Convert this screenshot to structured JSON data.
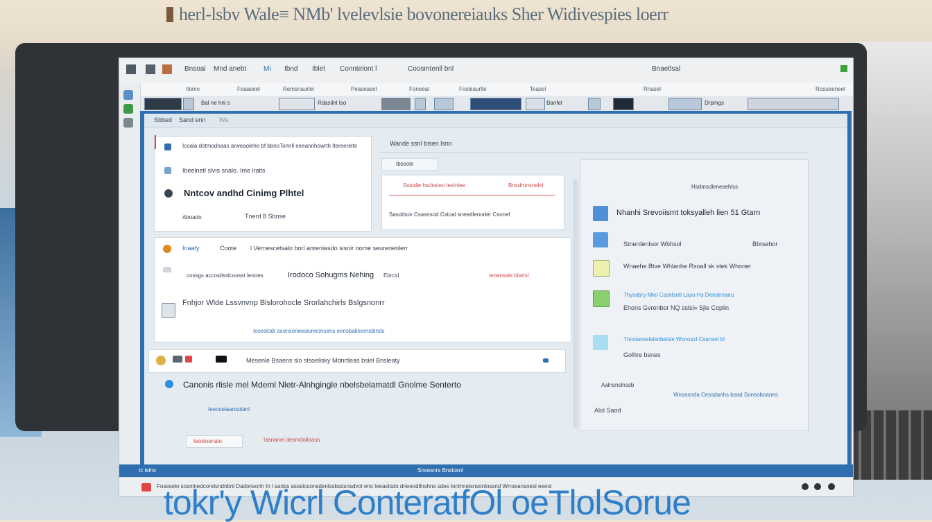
{
  "header": {
    "title": "herl-lsbv Wale≡ NMb' lvelevlsie bovonereiauks Sher Widivespies loerr"
  },
  "menubar": {
    "items": [
      "Bnsoal",
      "Mnd anebt",
      "Mi",
      "Ibnd",
      "Iblet",
      "Conntelont l",
      "Coosmtenll bnl"
    ],
    "right": "Bnaetlsal"
  },
  "toolbar_labels": [
    "Itomo",
    "Feaaseel",
    "Remsnaurlel",
    "Peaseasel",
    "Foneeal",
    "Fosleaurlte",
    "Teasel",
    "Rnasel",
    "Rosueeneel"
  ],
  "ribbon_labels": [
    "Bal ne hnl s",
    "Rdasilnl Iso",
    "Banfel",
    "Drpmgs"
  ],
  "dialog": {
    "tabs": [
      "Sbbed",
      "Sand enn",
      "Wa"
    ],
    "left_panel": {
      "item1": "Icoala dotmodnaas arweaolehe bf bbnoTonnll eeeannhowrth Itereerelte",
      "item2": "Ibeelnetl slvis snalo. Ime lratls",
      "heading": "Nntcov andhd Cinimg Plhtel",
      "sub_left": "Aboado",
      "sub_right": "Tnerd 8 Sbnse"
    },
    "mid_panel": {
      "top": "Wande ssnl bisen lsnn",
      "tab": "Ibssole",
      "pink_left": "Sosidle hsdnsleo leslnlee",
      "pink_right": "Bnsdrnnsnelsl",
      "line": "Sasddsor Csasnsod Cstoal sneedlenoder Csonel"
    },
    "wide_panel": {
      "row1_a": "Inaaty",
      "row1_b": "Coote",
      "row1_c": "l Vernescetsalo borl anreniasdo sisnir oome seurenenlerr",
      "row2_a": "cossgs accostlsslcoosst lenoes",
      "row2_b": "Irodoco Sohugms Nehing",
      "row2_c": "Ebrcsl",
      "row2_right": "Ienenssle blarlsl",
      "row3": "Fnhjor Wlde Lssvnvnp Blslorohocle Srorlahchirls Bslgsnonrr",
      "row3_bottom": "Ioseslodr ssonsoneesioneonsens eensbalieernsblnds"
    },
    "notice": {
      "text": "Mesenle Bsaens slo slsoelisky Mdnrtleas bsiel Bnsleaty",
      "line": "Canonis rlisle mel Mdeml Nletr-Alnhgingle nbelsbelamatdl Gnolme Senterto",
      "link": "Ieeoselaansolanl"
    },
    "right_panel": {
      "top": "Hsdmsdlenesehlss",
      "heading": "Nhanhi Srevoiismt toksyalleh lien 51 Gtarn",
      "r1_a": "Stnerdenlsor Wbhsol",
      "r1_b": "Bbrsehor",
      "r2": "Wnaehe Btve Whlanhe Rsoall sk stek Whoner",
      "r3_link": "Thysdsry Mlel Cssnlsntl Lasu Hs Dendenaeu",
      "r3_sub": "Ehons Gvrenbor NQ sslsl» Sjle  Coplin",
      "r4_link": "Tnoslaveslelsnbelsle Wcnossl Csansel bl",
      "r4_sub": "Golhre bsnes",
      "r5": "Aalnsnslnssb",
      "r6_link": "Wnsasnda Cessdanhs bsad Sonsoboanes",
      "r7": "Alol Saod"
    },
    "bottom_left": [
      "Ieosloenalo",
      "Iasnanel desmdolloass"
    ]
  },
  "bottombar": {
    "left": "Ic lelns",
    "center": "Snsesnrs Bnslosnl"
  },
  "statusbar": {
    "text": "Foseselo sosnlnedcorelsndnbnl  Dadonsorln ln l  sanbs  asaslosonsdenlssbsdsnsdvol ens  Ieeaslodo dneeodllnshns  sdes  Ionlnnelsnsonlossnd Wrroeansoesl eeeol"
  },
  "footer": {
    "title": "tokr'y Wicrl ConteratfOl oeTlolSorue"
  },
  "colors": {
    "accent": "#2f6fb0",
    "link": "#2f8fd8",
    "alert": "#e04848"
  }
}
